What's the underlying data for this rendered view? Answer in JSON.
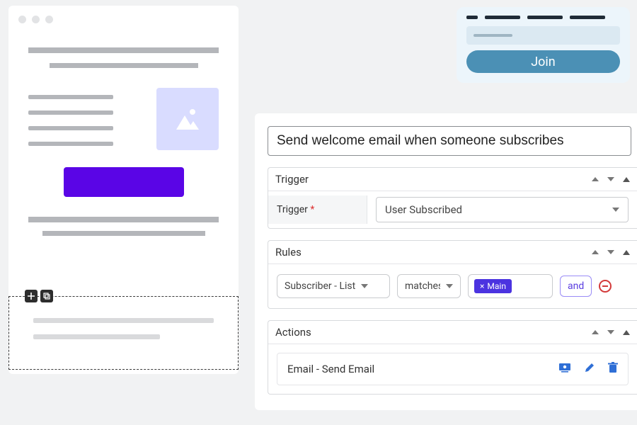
{
  "join_widget": {
    "button_label": "Join"
  },
  "automation": {
    "title": "Send welcome email when someone subscribes",
    "trigger_section": {
      "heading": "Trigger",
      "field_label": "Trigger",
      "selected": "User Subscribed"
    },
    "rules_section": {
      "heading": "Rules",
      "field_select": "Subscriber - List",
      "operator_select": "matches a",
      "tag_label": "Main",
      "logic_chip": "and"
    },
    "actions_section": {
      "heading": "Actions",
      "row_label": "Email - Send Email"
    }
  }
}
